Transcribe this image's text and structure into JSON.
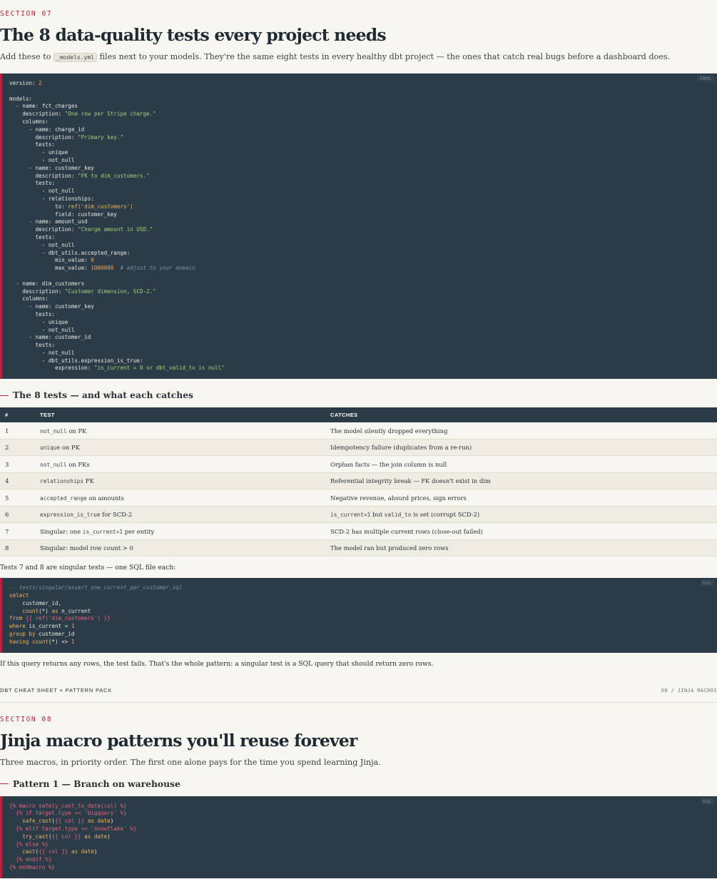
{
  "section07": {
    "eyebrow": "SECTION 07",
    "title": "The 8 data-quality tests every project needs",
    "lede_before": "Add these to ",
    "lede_code": "_models.yml",
    "lede_after": " files next to your models. They're the same eight tests in every healthy dbt project — the ones that catch real bugs before a dashboard does.",
    "yaml_lang": "YAML",
    "yaml_lines": [
      [
        [
          "k",
          "version: "
        ],
        [
          "n",
          "2"
        ]
      ],
      [],
      [
        [
          "k",
          "models:"
        ]
      ],
      [
        [
          "k",
          "  - name: fct_charges"
        ]
      ],
      [
        [
          "k",
          "    description: "
        ],
        [
          "s",
          "\"One row per Stripe charge.\""
        ]
      ],
      [
        [
          "k",
          "    columns:"
        ]
      ],
      [
        [
          "k",
          "      - name: charge_id"
        ]
      ],
      [
        [
          "k",
          "        description: "
        ],
        [
          "s",
          "\"Primary key.\""
        ]
      ],
      [
        [
          "k",
          "        tests:"
        ]
      ],
      [
        [
          "k",
          "          - unique"
        ]
      ],
      [
        [
          "k",
          "          - not_null"
        ]
      ],
      [
        [
          "k",
          "      - name: customer_key"
        ]
      ],
      [
        [
          "k",
          "        description: "
        ],
        [
          "s",
          "\"FK to dim_customers.\""
        ]
      ],
      [
        [
          "k",
          "        tests:"
        ]
      ],
      [
        [
          "k",
          "          - not_null"
        ]
      ],
      [
        [
          "k",
          "          - relationships:"
        ]
      ],
      [
        [
          "k",
          "              to: "
        ],
        [
          "kw",
          "ref('dim_customers')"
        ]
      ],
      [
        [
          "k",
          "              field: customer_key"
        ]
      ],
      [
        [
          "k",
          "      - name: amount_usd"
        ]
      ],
      [
        [
          "k",
          "        description: "
        ],
        [
          "s",
          "\"Charge amount in USD.\""
        ]
      ],
      [
        [
          "k",
          "        tests:"
        ]
      ],
      [
        [
          "k",
          "          - not_null"
        ]
      ],
      [
        [
          "k",
          "          - dbt_utils.accepted_range:"
        ]
      ],
      [
        [
          "k",
          "              min_value: "
        ],
        [
          "n",
          "0"
        ]
      ],
      [
        [
          "k",
          "              max_value: "
        ],
        [
          "n",
          "1000000"
        ],
        [
          "c",
          "  # adjust to your domain"
        ]
      ],
      [],
      [
        [
          "k",
          "  - name: dim_customers"
        ]
      ],
      [
        [
          "k",
          "    description: "
        ],
        [
          "s",
          "\"Customer dimension, SCD-2.\""
        ]
      ],
      [
        [
          "k",
          "    columns:"
        ]
      ],
      [
        [
          "k",
          "      - name: customer_key"
        ]
      ],
      [
        [
          "k",
          "        tests:"
        ]
      ],
      [
        [
          "k",
          "          - unique"
        ]
      ],
      [
        [
          "k",
          "          - not_null"
        ]
      ],
      [
        [
          "k",
          "      - name: customer_id"
        ]
      ],
      [
        [
          "k",
          "        tests:"
        ]
      ],
      [
        [
          "k",
          "          - not_null"
        ]
      ],
      [
        [
          "k",
          "          - dbt_utils.expression_is_true:"
        ]
      ],
      [
        [
          "k",
          "              expression: "
        ],
        [
          "s",
          "\"is_current = 0 or dbt_valid_to is null\""
        ]
      ]
    ],
    "tests_heading": "The 8 tests — and what each catches",
    "table": {
      "headers": [
        "#",
        "TEST",
        "CATCHES"
      ],
      "rows": [
        {
          "num": "1",
          "test": [
            [
              "code",
              "not_null"
            ],
            [
              "t",
              " on PK"
            ]
          ],
          "catches": [
            [
              "t",
              "The model silently dropped everything"
            ]
          ]
        },
        {
          "num": "2",
          "test": [
            [
              "code",
              "unique"
            ],
            [
              "t",
              " on PK"
            ]
          ],
          "catches": [
            [
              "t",
              "Idempotency failure (duplicates from a re-run)"
            ]
          ]
        },
        {
          "num": "3",
          "test": [
            [
              "code",
              "not_null"
            ],
            [
              "t",
              " on FKs"
            ]
          ],
          "catches": [
            [
              "t",
              "Orphan facts — the join column is null"
            ]
          ]
        },
        {
          "num": "4",
          "test": [
            [
              "code",
              "relationships"
            ],
            [
              "t",
              " FK"
            ]
          ],
          "catches": [
            [
              "t",
              "Referential integrity break — FK doesn't exist in dim"
            ]
          ]
        },
        {
          "num": "5",
          "test": [
            [
              "code",
              "accepted_range"
            ],
            [
              "t",
              " on amounts"
            ]
          ],
          "catches": [
            [
              "t",
              "Negative revenue, absurd prices, sign errors"
            ]
          ]
        },
        {
          "num": "6",
          "test": [
            [
              "code",
              "expression_is_true"
            ],
            [
              "t",
              " for SCD-2"
            ]
          ],
          "catches": [
            [
              "code",
              "is_current=1"
            ],
            [
              "t",
              " but "
            ],
            [
              "code",
              "valid_to"
            ],
            [
              "t",
              " is set (corrupt SCD-2)"
            ]
          ]
        },
        {
          "num": "7",
          "test": [
            [
              "t",
              "Singular: one "
            ],
            [
              "code",
              "is_current=1"
            ],
            [
              "t",
              " per entity"
            ]
          ],
          "catches": [
            [
              "t",
              "SCD-2 has multiple current rows (close-out failed)"
            ]
          ]
        },
        {
          "num": "8",
          "test": [
            [
              "t",
              "Singular: model row count > 0"
            ]
          ],
          "catches": [
            [
              "t",
              "The model ran but produced zero rows"
            ]
          ]
        }
      ]
    },
    "singular_intro": "Tests 7 and 8 are singular tests — one SQL file each:",
    "sql_lang": "SQL",
    "sql_lines": [
      [
        [
          "c",
          "-- tests/singular/assert_one_current_per_customer.sql"
        ]
      ],
      [
        [
          "kw",
          "select"
        ]
      ],
      [
        [
          "k",
          "    customer_id,"
        ]
      ],
      [
        [
          "kw",
          "    count"
        ],
        [
          "k",
          "(*) "
        ],
        [
          "kw",
          "as"
        ],
        [
          "k",
          " n_current"
        ]
      ],
      [
        [
          "kw",
          "from"
        ],
        [
          "jj",
          " {{ ref('dim_customers') }}"
        ]
      ],
      [
        [
          "kw",
          "where"
        ],
        [
          "k",
          " is_current = "
        ],
        [
          "n",
          "1"
        ]
      ],
      [
        [
          "kw",
          "group by"
        ],
        [
          "k",
          " customer_id"
        ]
      ],
      [
        [
          "kw",
          "having"
        ],
        [
          "kw",
          " count"
        ],
        [
          "k",
          "(*) <> "
        ],
        [
          "n",
          "1"
        ]
      ]
    ],
    "singular_outro": "If this query returns any rows, the test fails. That's the whole pattern: a singular test is a SQL query that should return zero rows."
  },
  "footer": {
    "left": "DBT CHEAT SHEET + PATTERN PACK",
    "right": "08 / JINJA MACROS"
  },
  "section08": {
    "eyebrow": "SECTION 08",
    "title": "Jinja macro patterns you'll reuse forever",
    "lede": "Three macros, in priority order. The first one alone pays for the time you spend learning Jinja.",
    "pattern1_heading": "Pattern 1 — Branch on warehouse",
    "sql_lang": "SQL",
    "macro_lines": [
      [
        [
          "jj",
          "{% macro safely_cast_to_date(col) %}"
        ]
      ],
      [
        [
          "jj",
          "  {% if target.type == 'bigquery' %}"
        ]
      ],
      [
        [
          "kw",
          "    safe_cast"
        ],
        [
          "k",
          "("
        ],
        [
          "jj",
          "{{ col }}"
        ],
        [
          "kw",
          " as date"
        ],
        [
          "k",
          ")"
        ]
      ],
      [
        [
          "jj",
          "  {% elif target.type == 'snowflake' %}"
        ]
      ],
      [
        [
          "kw",
          "    try_cast"
        ],
        [
          "k",
          "("
        ],
        [
          "jj",
          "{{ col }}"
        ],
        [
          "kw",
          " as date"
        ],
        [
          "k",
          ")"
        ]
      ],
      [
        [
          "jj",
          "  {% else %}"
        ]
      ],
      [
        [
          "kw",
          "    cast"
        ],
        [
          "k",
          "("
        ],
        [
          "jj",
          "{{ col }}"
        ],
        [
          "kw",
          " as date"
        ],
        [
          "k",
          ")"
        ]
      ],
      [
        [
          "jj",
          "  {% endif %}"
        ]
      ],
      [
        [
          "jj",
          "{% endmacro %}"
        ]
      ]
    ]
  }
}
